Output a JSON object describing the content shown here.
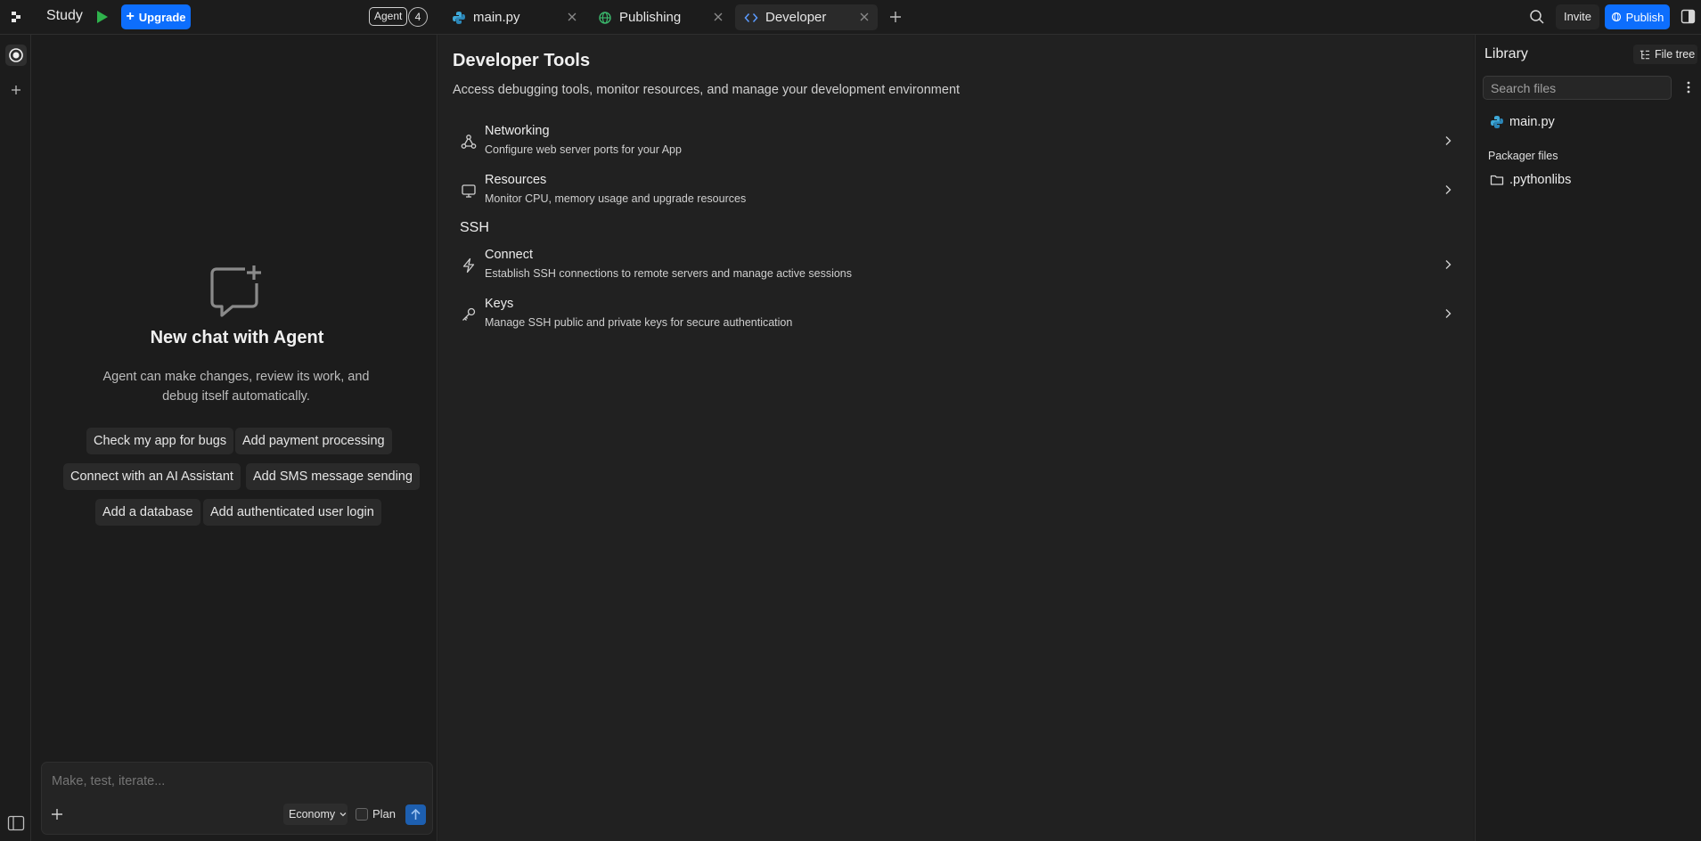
{
  "topbar": {
    "app_name": "Study",
    "upgrade_label": "Upgrade",
    "agent_badge": "Agent",
    "agent_count": "4",
    "tabs": [
      {
        "label": "main.py",
        "icon": "python-icon",
        "active": false
      },
      {
        "label": "Publishing",
        "icon": "globe-icon",
        "active": false
      },
      {
        "label": "Developer",
        "icon": "code-icon",
        "active": true
      }
    ],
    "invite_label": "Invite",
    "publish_label": "Publish",
    "brand_color": "#0d6efd"
  },
  "chat": {
    "title": "New chat with Agent",
    "description": "Agent can make changes, review its work, and debug itself automatically.",
    "suggestions": [
      "Check my app for bugs",
      "Add payment processing",
      "Connect with an AI Assistant",
      "Add SMS message sending",
      "Add a database",
      "Add authenticated user login"
    ],
    "input_placeholder": "Make, test, iterate...",
    "mode_label": "Economy",
    "plan_label": "Plan"
  },
  "developer": {
    "title": "Developer Tools",
    "subtitle": "Access debugging tools, monitor resources, and manage your development environment",
    "items": [
      {
        "title": "Networking",
        "desc": "Configure web server ports for your App",
        "icon": "network-icon"
      },
      {
        "title": "Resources",
        "desc": "Monitor CPU, memory usage and upgrade resources",
        "icon": "monitor-icon"
      }
    ],
    "ssh_heading": "SSH",
    "ssh_items": [
      {
        "title": "Connect",
        "desc": "Establish SSH connections to remote servers and manage active sessions",
        "icon": "bolt-icon"
      },
      {
        "title": "Keys",
        "desc": "Manage SSH public and private keys for secure authentication",
        "icon": "key-icon"
      }
    ]
  },
  "library": {
    "title": "Library",
    "file_tree_label": "File tree",
    "search_placeholder": "Search files",
    "files": [
      "main.py"
    ],
    "packager_heading": "Packager files",
    "packager_items": [
      ".pythonlibs"
    ]
  }
}
